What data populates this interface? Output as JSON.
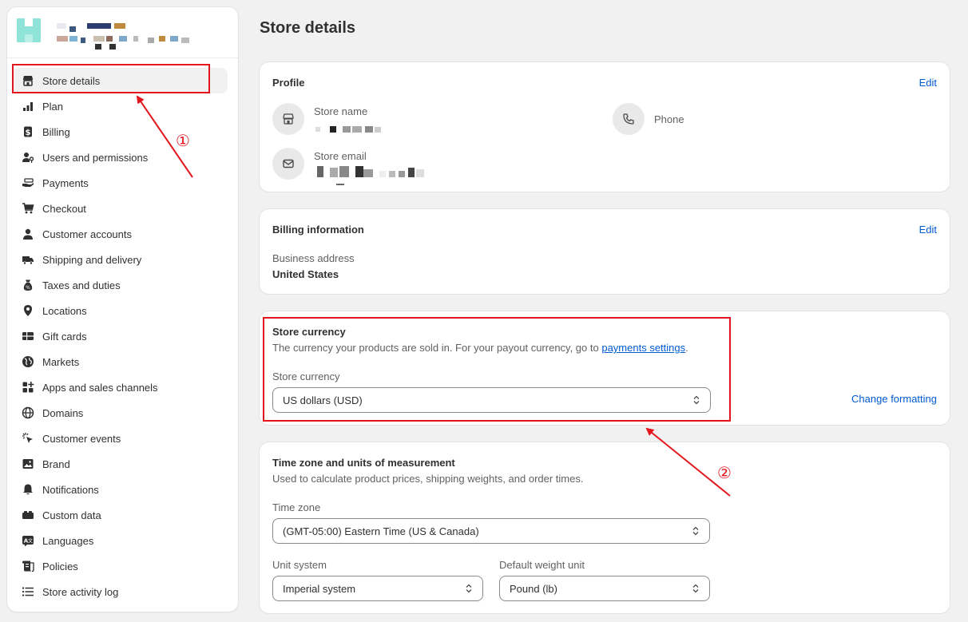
{
  "sidebar": {
    "items": [
      {
        "label": "Store details",
        "icon": "store-icon"
      },
      {
        "label": "Plan",
        "icon": "plan-chart-icon"
      },
      {
        "label": "Billing",
        "icon": "dollar-icon"
      },
      {
        "label": "Users and permissions",
        "icon": "user-key-icon"
      },
      {
        "label": "Payments",
        "icon": "hand-money-icon"
      },
      {
        "label": "Checkout",
        "icon": "cart-icon"
      },
      {
        "label": "Customer accounts",
        "icon": "person-icon"
      },
      {
        "label": "Shipping and delivery",
        "icon": "truck-icon"
      },
      {
        "label": "Taxes and duties",
        "icon": "tax-bag-icon"
      },
      {
        "label": "Locations",
        "icon": "location-pin-icon"
      },
      {
        "label": "Gift cards",
        "icon": "gift-card-icon"
      },
      {
        "label": "Markets",
        "icon": "globe-icon"
      },
      {
        "label": "Apps and sales channels",
        "icon": "apps-icon"
      },
      {
        "label": "Domains",
        "icon": "domain-globe-icon"
      },
      {
        "label": "Customer events",
        "icon": "cursor-click-icon"
      },
      {
        "label": "Brand",
        "icon": "brand-image-icon"
      },
      {
        "label": "Notifications",
        "icon": "bell-icon"
      },
      {
        "label": "Custom data",
        "icon": "custom-data-icon"
      },
      {
        "label": "Languages",
        "icon": "language-icon"
      },
      {
        "label": "Policies",
        "icon": "policy-icon"
      },
      {
        "label": "Store activity log",
        "icon": "list-icon"
      }
    ]
  },
  "page": {
    "title": "Store details"
  },
  "profile": {
    "title": "Profile",
    "edit": "Edit",
    "store_name_label": "Store name",
    "store_email_label": "Store email",
    "phone_label": "Phone"
  },
  "billing": {
    "title": "Billing information",
    "edit": "Edit",
    "address_label": "Business address",
    "address_value": "United States"
  },
  "currency": {
    "title": "Store currency",
    "desc_prefix": "The currency your products are sold in. For your payout currency, go to ",
    "desc_link": "payments settings",
    "desc_suffix": ".",
    "field_label": "Store currency",
    "selected": "US dollars (USD)",
    "change_formatting": "Change formatting"
  },
  "timezone": {
    "title": "Time zone and units of measurement",
    "desc": "Used to calculate product prices, shipping weights, and order times.",
    "tz_label": "Time zone",
    "tz_value": "(GMT-05:00) Eastern Time (US & Canada)",
    "unit_label": "Unit system",
    "unit_value": "Imperial system",
    "weight_label": "Default weight unit",
    "weight_value": "Pound (lb)"
  },
  "annotations": {
    "one": "①",
    "two": "②",
    "color": "#e3161d"
  },
  "colors": {
    "accent_link": "#005bd3",
    "background": "#f1f1f1",
    "card": "#ffffff"
  }
}
